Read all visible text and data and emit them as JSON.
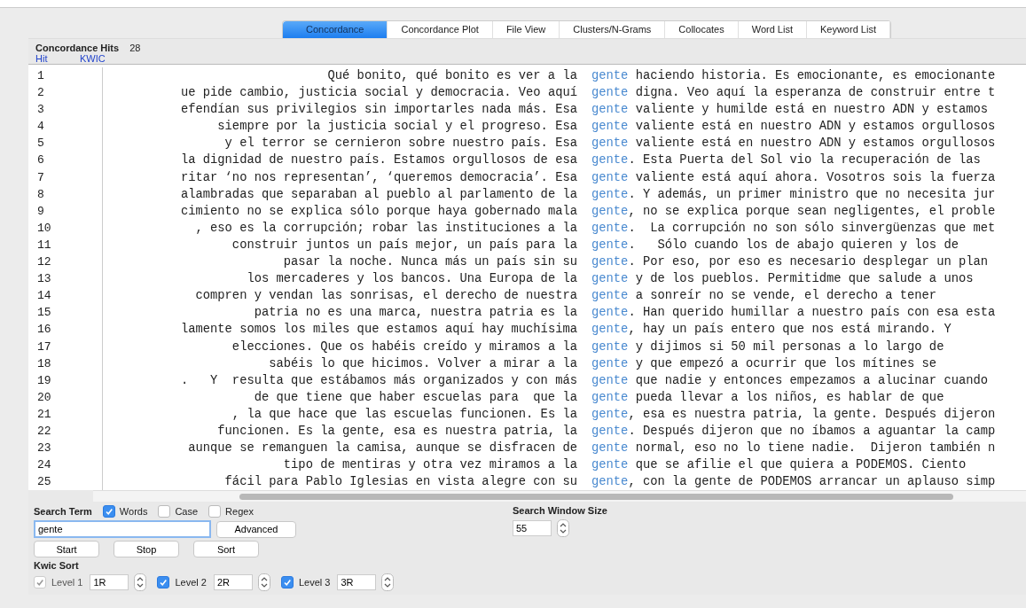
{
  "tabs": [
    {
      "label": "Concordance",
      "selected": true
    },
    {
      "label": "Concordance Plot",
      "selected": false
    },
    {
      "label": "File View",
      "selected": false
    },
    {
      "label": "Clusters/N-Grams",
      "selected": false
    },
    {
      "label": "Collocates",
      "selected": false
    },
    {
      "label": "Word List",
      "selected": false
    },
    {
      "label": "Keyword List",
      "selected": false
    }
  ],
  "hits": {
    "label": "Concordance Hits",
    "count": "28"
  },
  "table": {
    "columns": [
      "Hit",
      "KWIC"
    ],
    "rows": [
      {
        "hit": "1",
        "left": "Qué bonito, qué bonito es ver a la",
        "node": "gente",
        "right": " haciendo historia. Es emocionante, es emocionante"
      },
      {
        "hit": "2",
        "left": "ue pide cambio, justicia social y democracia. Veo aquí",
        "node": "gente",
        "right": " digna. Veo aquí la esperanza de construir entre t"
      },
      {
        "hit": "3",
        "left": "efendían sus privilegios sin importarles nada más. Esa",
        "node": "gente",
        "right": " valiente y humilde está en nuestro ADN y estamos"
      },
      {
        "hit": "4",
        "left": "siempre por la justicia social y el progreso. Esa",
        "node": "gente",
        "right": " valiente está en nuestro ADN y estamos orgullosos"
      },
      {
        "hit": "5",
        "left": "y el terror se cernieron sobre nuestro país. Esa",
        "node": "gente",
        "right": " valiente está en nuestro ADN y estamos orgullosos"
      },
      {
        "hit": "6",
        "left": "la dignidad de nuestro país. Estamos orgullosos de esa",
        "node": "gente",
        "right": ". Esta Puerta del Sol vio la recuperación de las"
      },
      {
        "hit": "7",
        "left": "ritar ‘no nos representan’, ‘queremos democracia’. Esa",
        "node": "gente",
        "right": " valiente está aquí ahora. Vosotros sois la fuerza"
      },
      {
        "hit": "8",
        "left": "alambradas que separaban al pueblo al parlamento de la",
        "node": "gente",
        "right": ". Y además, un primer ministro que no necesita jur"
      },
      {
        "hit": "9",
        "left": "cimiento no se explica sólo porque haya gobernado mala",
        "node": "gente",
        "right": ", no se explica porque sean negligentes, el proble"
      },
      {
        "hit": "10",
        "left": ", eso es la corrupción; robar las instituciones a la",
        "node": "gente",
        "right": ".  La corrupción no son sólo sinvergüenzas que met"
      },
      {
        "hit": "11",
        "left": "construir juntos un país mejor, un país para la",
        "node": "gente",
        "right": ".   Sólo cuando los de abajo quieren y los de"
      },
      {
        "hit": "12",
        "left": "pasar la noche. Nunca más un país sin su",
        "node": "gente",
        "right": ". Por eso, por eso es necesario desplegar un plan"
      },
      {
        "hit": "13",
        "left": "los mercaderes y los bancos. Una Europa de la",
        "node": "gente",
        "right": " y de los pueblos. Permitidme que salude a unos"
      },
      {
        "hit": "14",
        "left": "compren y vendan las sonrisas, el derecho de nuestra",
        "node": "gente",
        "right": " a sonreír no se vende, el derecho a tener"
      },
      {
        "hit": "15",
        "left": "patria no es una marca, nuestra patria es la",
        "node": "gente",
        "right": ". Han querido humillar a nuestro país con esa esta"
      },
      {
        "hit": "16",
        "left": "lamente somos los miles que estamos aquí hay muchísima",
        "node": "gente",
        "right": ", hay un país entero que nos está mirando. Y"
      },
      {
        "hit": "17",
        "left": "elecciones. Que os habéis creído y miramos a la",
        "node": "gente",
        "right": " y dijimos si 50 mil personas a lo largo de"
      },
      {
        "hit": "18",
        "left": "sabéis lo que hicimos. Volver a mirar a la",
        "node": "gente",
        "right": " y que empezó a ocurrir que los mítines se"
      },
      {
        "hit": "19",
        "left": ".   Y  resulta que estábamos más organizados y con más",
        "node": "gente",
        "right": " que nadie y entonces empezamos a alucinar cuando"
      },
      {
        "hit": "20",
        "left": "de que tiene que haber escuelas para  que la",
        "node": "gente",
        "right": " pueda llevar a los niños, es hablar de que"
      },
      {
        "hit": "21",
        "left": ", la que hace que las escuelas funcionen. Es la",
        "node": "gente",
        "right": ", esa es nuestra patria, la gente. Después dijeron"
      },
      {
        "hit": "22",
        "left": "funcionen. Es la gente, esa es nuestra patria, la",
        "node": "gente",
        "right": ". Después dijeron que no íbamos a aguantar la camp"
      },
      {
        "hit": "23",
        "left": "aunque se remanguen la camisa, aunque se disfracen de",
        "node": "gente",
        "right": " normal, eso no lo tiene nadie.  Dijeron también n"
      },
      {
        "hit": "24",
        "left": "tipo de mentiras y otra vez miramos a la",
        "node": "gente",
        "right": " que se afilie el que quiera a PODEMOS. Ciento"
      },
      {
        "hit": "25",
        "left": "fácil para Pablo Iglesias en vista alegre con su",
        "node": "gente",
        "right": ", con la gente de PODEMOS arrancar un aplauso simp"
      }
    ]
  },
  "search": {
    "label": "Search Term",
    "options": [
      {
        "label": "Words",
        "checked": true
      },
      {
        "label": "Case",
        "checked": false
      },
      {
        "label": "Regex",
        "checked": false
      }
    ],
    "value": "gente",
    "advanced": "Advanced",
    "buttons": [
      "Start",
      "Stop",
      "Sort"
    ],
    "window_size": {
      "label": "Search Window Size",
      "value": "55"
    }
  },
  "kwic_sort": {
    "label": "Kwic Sort",
    "levels": [
      {
        "label": "Level 1",
        "value": "1R",
        "checked": true,
        "disabled": true
      },
      {
        "label": "Level 2",
        "value": "2R",
        "checked": true,
        "disabled": false
      },
      {
        "label": "Level 3",
        "value": "3R",
        "checked": true,
        "disabled": false
      }
    ]
  }
}
